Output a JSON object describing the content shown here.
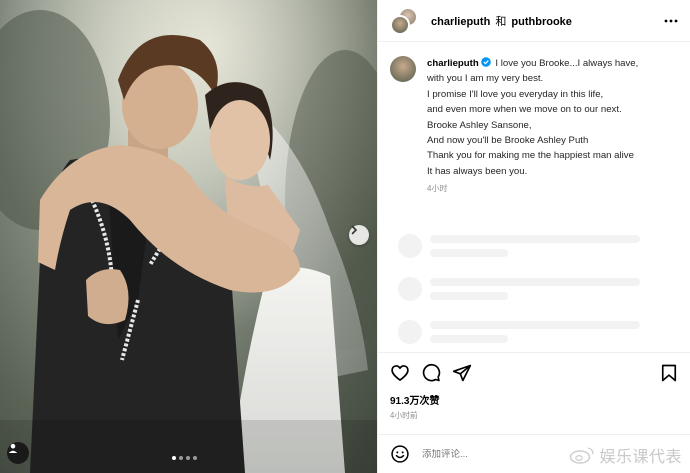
{
  "header": {
    "user1": "charlieputh",
    "and_text": "和",
    "user2": "puthbrooke",
    "more_icon": "more-horizontal-icon"
  },
  "caption": {
    "username": "charlieputh",
    "verified_icon": "verified-badge-icon",
    "lines": [
      "I love you Brooke...I always have,",
      "with you I am my very best.",
      "I promise I'll love you everyday in this life,",
      "and even more when we move on to our next.",
      "Brooke Ashley Sansone,",
      "And now you'll be Brooke Ashley Puth",
      "Thank you for making me the happiest man alive",
      "It has always been you."
    ],
    "time": "4小时"
  },
  "carousel": {
    "next_icon": "chevron-right-icon",
    "tag_icon": "tagged-user-icon",
    "dot_count": 4,
    "active_index": 0
  },
  "actions": {
    "like_icon": "heart-icon",
    "comment_icon": "comment-icon",
    "share_icon": "share-icon",
    "save_icon": "bookmark-icon"
  },
  "stats": {
    "likes": "91.3万次赞",
    "time": "4小时前"
  },
  "comment": {
    "emoji_icon": "emoji-icon",
    "placeholder": "添加评论..."
  },
  "watermark": {
    "text": "娱乐课代表"
  },
  "colors": {
    "verified": "#0095f6",
    "muted": "#8e8e8e",
    "skeleton": "#f2f2f2"
  }
}
